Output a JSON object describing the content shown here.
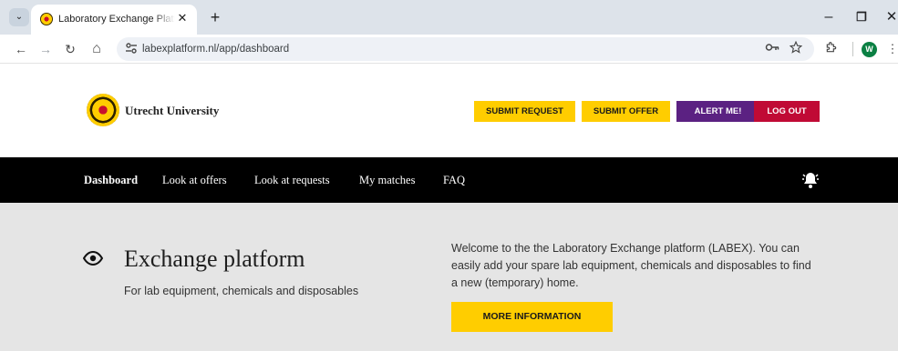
{
  "browser": {
    "tab_title": "Laboratory Exchange Platform (",
    "tab_close": "✕",
    "new_tab": "+",
    "tab_list": "⌄",
    "window": {
      "minimize": "–",
      "maximize": "❐",
      "close": "✕"
    },
    "nav": {
      "back": "←",
      "forward": "→",
      "reload": "↻",
      "home": "⌂"
    },
    "url": "labexplatform.nl/app/dashboard",
    "profile_initial": "W",
    "icons": {
      "site_info": "tune-icon",
      "password_key": "key-icon",
      "bookmark": "star-icon",
      "extensions": "puzzle-icon",
      "menu": "kebab-icon"
    }
  },
  "header": {
    "logo_text": "Utrecht University",
    "buttons": {
      "submit_request": "SUBMIT REQUEST",
      "submit_offer": "SUBMIT OFFER",
      "alert": "ALERT ME!",
      "logout": "LOG OUT"
    }
  },
  "nav": {
    "dashboard": "Dashboard",
    "offers": "Look at offers",
    "requests": "Look at requests",
    "matches": "My matches",
    "faq": "FAQ"
  },
  "hero": {
    "title": "Exchange platform",
    "subtitle": "For lab equipment, chemicals and disposables",
    "description": "Welcome to the the Laboratory Exchange platform (LABEX). You can easily add your spare lab equipment, chemicals and disposables to find a new (temporary) home.",
    "button": "MORE INFORMATION"
  },
  "colors": {
    "uu_yellow": "#ffcd00",
    "alert_purple": "#5b2182",
    "logout_red": "#c00a35",
    "nav_black": "#000000",
    "hero_grey": "#e5e5e5"
  }
}
